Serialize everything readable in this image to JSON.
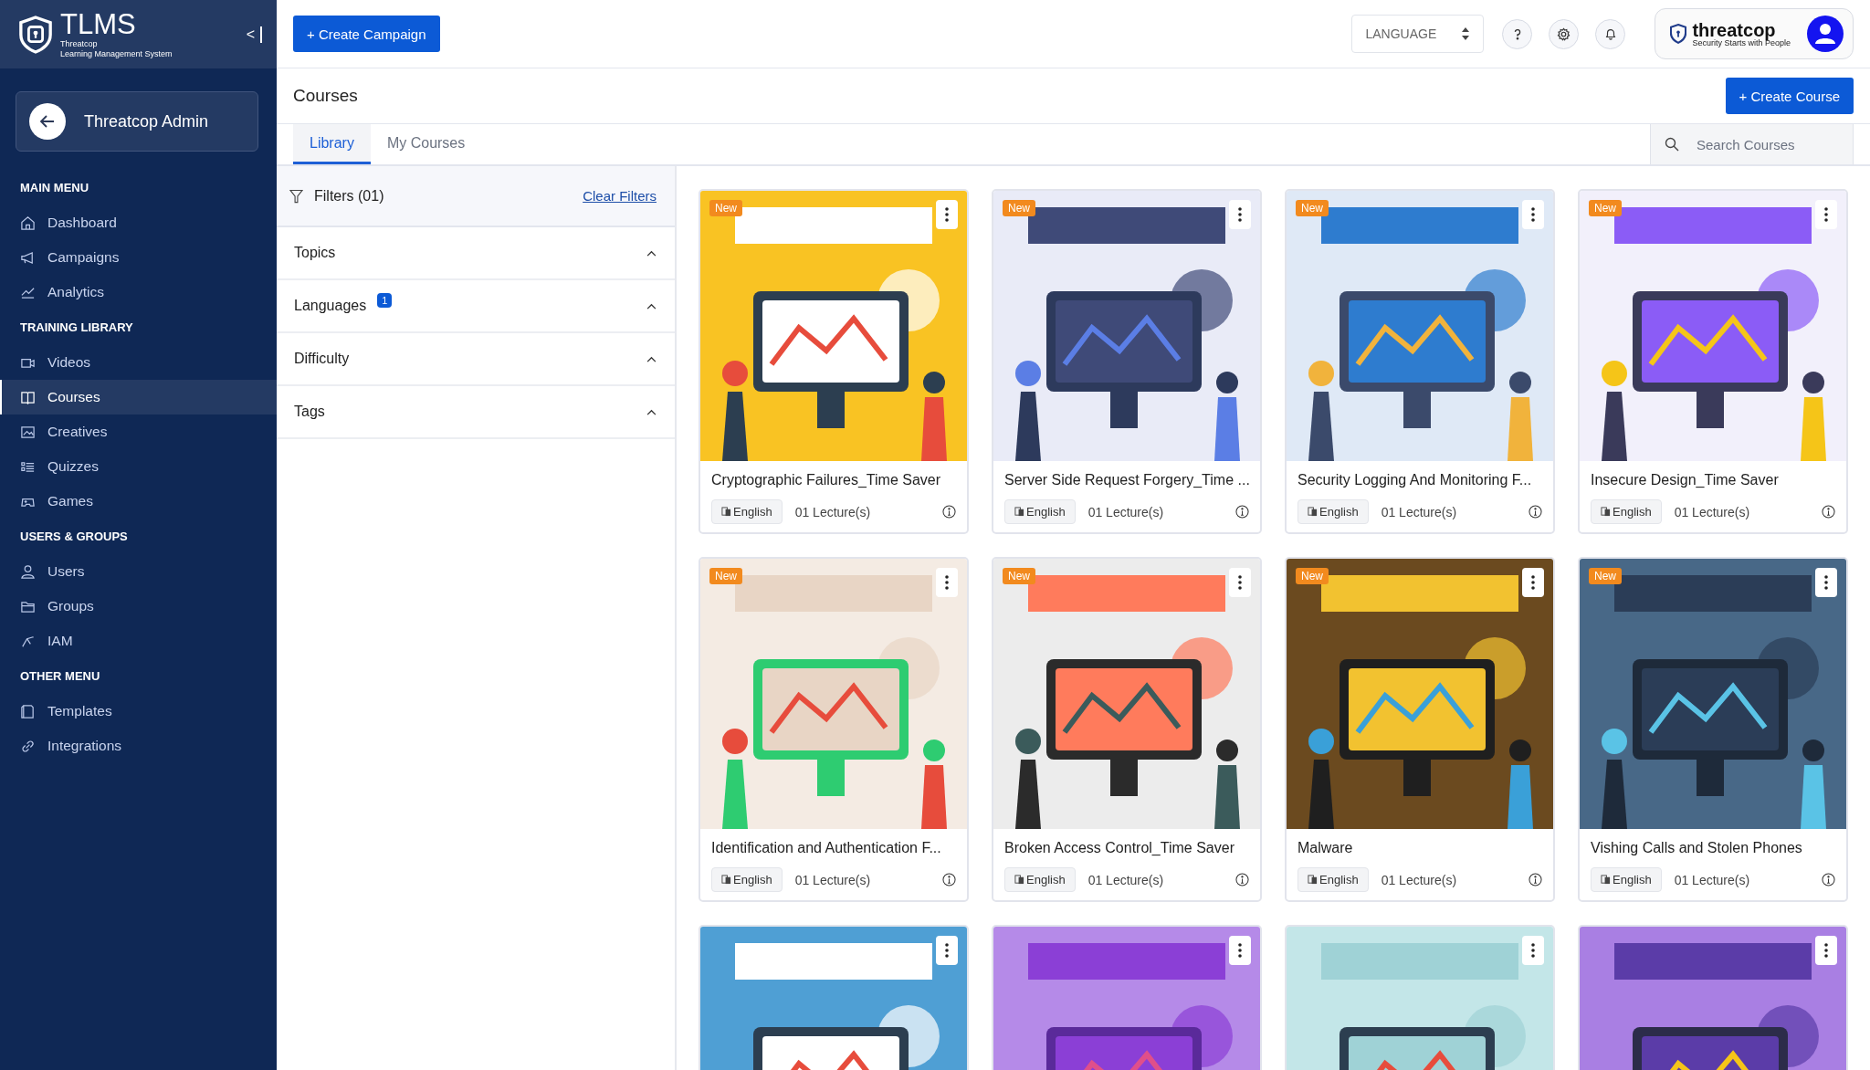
{
  "brand": {
    "name": "TLMS",
    "tagline_1": "Threatcop",
    "tagline_2": "Learning Management System",
    "collapse": "<"
  },
  "account": {
    "name": "Threatcop Admin"
  },
  "sidebar": {
    "sections": [
      {
        "heading": "MAIN MENU",
        "items": [
          {
            "label": "Dashboard",
            "selected": false
          },
          {
            "label": "Campaigns",
            "selected": false
          },
          {
            "label": "Analytics",
            "selected": false
          }
        ]
      },
      {
        "heading": "TRAINING LIBRARY",
        "items": [
          {
            "label": "Videos",
            "selected": false
          },
          {
            "label": "Courses",
            "selected": true
          },
          {
            "label": "Creatives",
            "selected": false
          },
          {
            "label": "Quizzes",
            "selected": false
          },
          {
            "label": "Games",
            "selected": false
          }
        ]
      },
      {
        "heading": "USERS & GROUPS",
        "items": [
          {
            "label": "Users",
            "selected": false
          },
          {
            "label": "Groups",
            "selected": false
          },
          {
            "label": "IAM",
            "selected": false
          }
        ]
      },
      {
        "heading": "OTHER MENU",
        "items": [
          {
            "label": "Templates",
            "selected": false
          },
          {
            "label": "Integrations",
            "selected": false
          }
        ]
      }
    ]
  },
  "topbar": {
    "create_button": "+ Create Campaign",
    "language": "LANGUAGE",
    "company_logo": "threatcop",
    "company_tagline": "Security Starts with People"
  },
  "page": {
    "title": "Courses",
    "create_button": "+ Create Course"
  },
  "tabs": [
    {
      "label": "Library",
      "selected": true
    },
    {
      "label": "My Courses",
      "selected": false
    }
  ],
  "search": {
    "placeholder": "Search Courses"
  },
  "filters": {
    "title": "Filters (01)",
    "clear": "Clear Filters",
    "groups": [
      {
        "label": "Topics",
        "expanded": true
      },
      {
        "label": "Languages",
        "expanded": true,
        "count": "1"
      },
      {
        "label": "Difficulty",
        "expanded": true
      },
      {
        "label": "Tags",
        "expanded": true
      }
    ]
  },
  "courses": [
    {
      "title": "Cryptographic Failures_Time Saver",
      "badge": "New",
      "language": "English",
      "lectures": "01 Lecture(s)",
      "kind": "picture"
    },
    {
      "title": "Server Side Request Forgery_Time ...",
      "badge": "New",
      "language": "English",
      "lectures": "01 Lecture(s)",
      "kind": "picture"
    },
    {
      "title": "Security Logging And Monitoring F...",
      "badge": "New",
      "language": "English",
      "lectures": "01 Lecture(s)",
      "kind": "picture"
    },
    {
      "title": "Insecure Design_Time Saver",
      "badge": "New",
      "language": "English",
      "lectures": "01 Lecture(s)",
      "kind": "picture"
    },
    {
      "title": "Identification and Authentication F...",
      "badge": "New",
      "language": "English",
      "lectures": "01 Lecture(s)",
      "kind": "picture"
    },
    {
      "title": "Broken Access Control_Time Saver",
      "badge": "New",
      "language": "English",
      "lectures": "01 Lecture(s)",
      "kind": "picture"
    },
    {
      "title": "Malware",
      "badge": "New",
      "language": "English",
      "lectures": "01 Lecture(s)",
      "kind": "picture"
    },
    {
      "title": "Vishing Calls and Stolen Phones",
      "badge": "New",
      "language": "English",
      "lectures": "01 Lecture(s)",
      "kind": "picture"
    },
    {
      "kind": "picture"
    },
    {
      "kind": "picture"
    },
    {
      "kind": "picture"
    },
    {
      "kind": "picture"
    }
  ]
}
